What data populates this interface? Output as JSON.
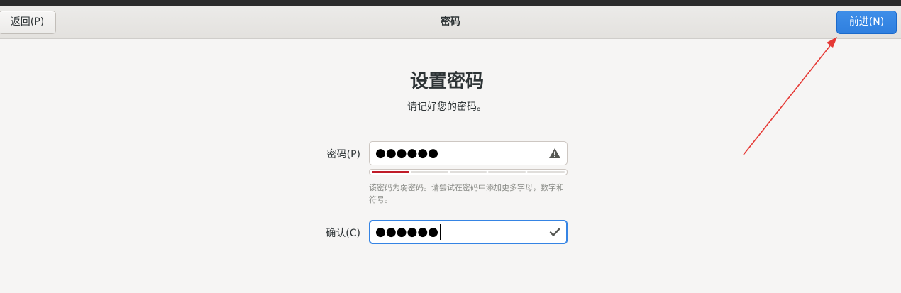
{
  "header": {
    "back_label": "返回(P)",
    "title": "密码",
    "next_label": "前进(N)"
  },
  "main": {
    "heading": "设置密码",
    "subtitle": "请记好您的密码。",
    "password": {
      "label": "密码(P)",
      "value": "●●●●●●",
      "icon": "warning-icon",
      "strength_level": 0.2,
      "strength_segments": 5,
      "hint": "该密码为弱密码。请尝试在密码中添加更多字母，数字和符号。"
    },
    "confirm": {
      "label": "确认(C)",
      "value": "●●●●●●",
      "icon": "checkmark-icon"
    }
  },
  "colors": {
    "accent": "#3584e4",
    "weak": "#c01c28",
    "annotation_arrow": "#e53935"
  }
}
